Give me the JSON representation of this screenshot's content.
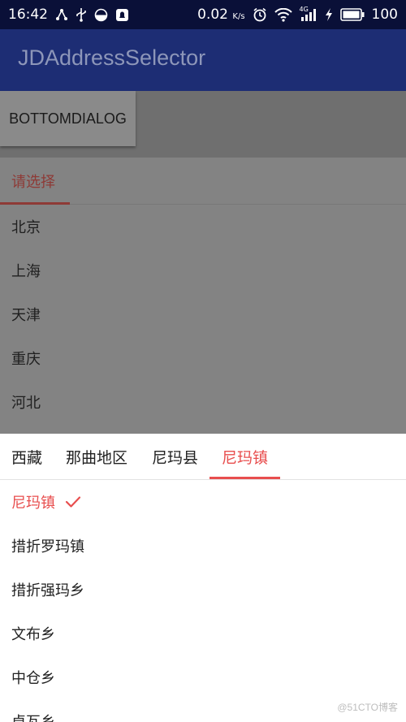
{
  "status_bar": {
    "time": "16:42",
    "network_speed": "0.02",
    "speed_unit": "K/s",
    "network_type": "4G",
    "battery": "100",
    "icons_left": [
      "share-icon",
      "usb-icon",
      "half-circle-icon",
      "notification-icon"
    ],
    "icons_right": [
      "alarm-icon",
      "wifi-icon",
      "signal-icon",
      "charging-icon",
      "battery-icon"
    ]
  },
  "app_bar": {
    "title": "JDAddressSelector"
  },
  "content": {
    "button_label": "BOTTOMDIALOG"
  },
  "dialog1": {
    "tab_label": "请选择",
    "items": [
      "北京",
      "上海",
      "天津",
      "重庆",
      "河北"
    ]
  },
  "dialog2": {
    "tabs": [
      "西藏",
      "那曲地区",
      "尼玛县",
      "尼玛镇"
    ],
    "active_tab": 3,
    "items": [
      "尼玛镇",
      "措折罗玛镇",
      "措折强玛乡",
      "文布乡",
      "中仓乡",
      "卓瓦乡"
    ],
    "selected_item": 0
  },
  "watermark": "@51CTO博客",
  "colors": {
    "accent": "#e84e4e",
    "appbar": "#1d2d74",
    "statusbar": "#0a1038"
  }
}
